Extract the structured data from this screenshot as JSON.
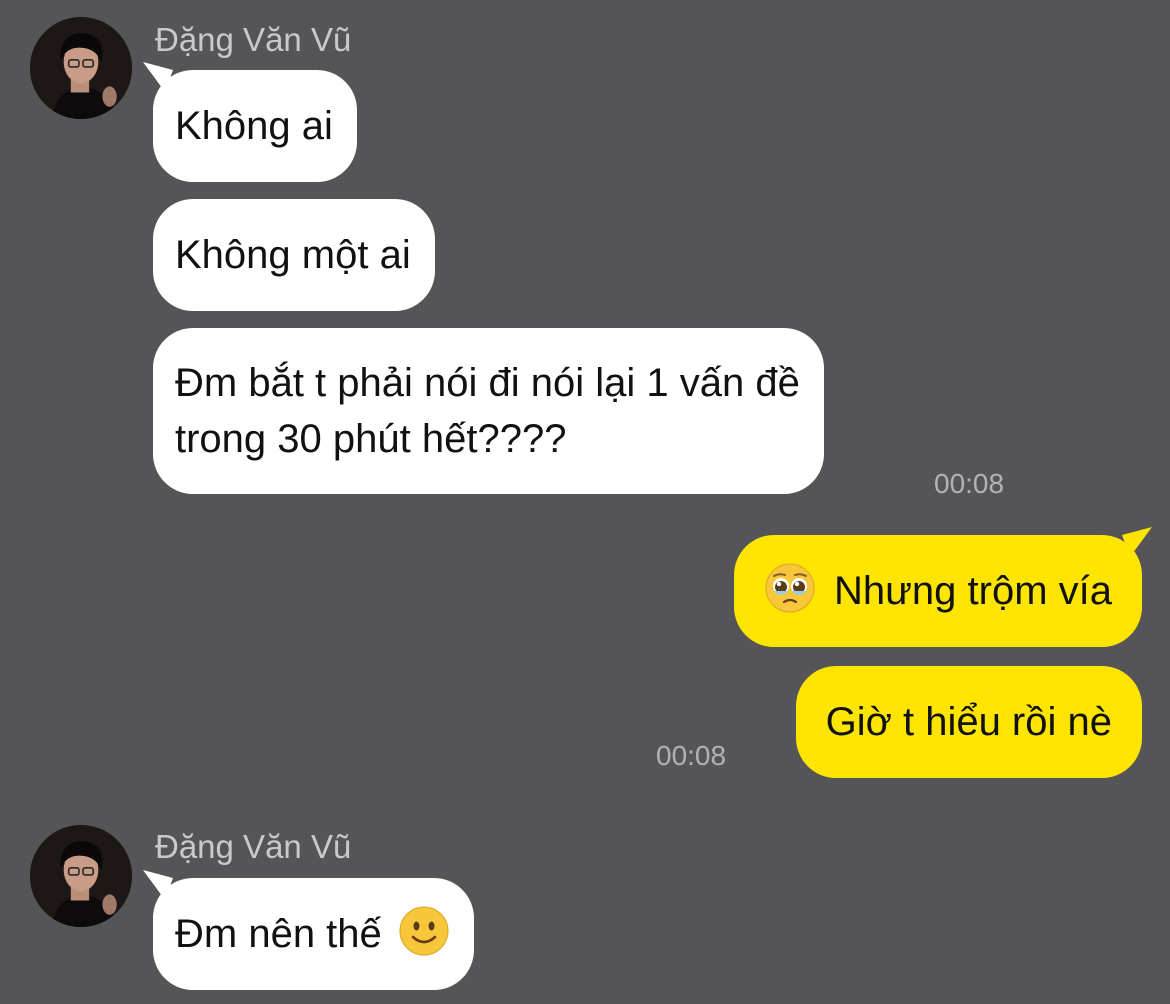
{
  "messages": [
    {
      "sender": "Đặng Văn Vũ"
    },
    {
      "text": "Không ai"
    },
    {
      "text": "Không một ai"
    },
    {
      "line1": "Đm bắt t phải nói đi nói lại 1 vấn đề",
      "line2": "trong 30 phút hết????",
      "time": "00:08"
    },
    {
      "emoji": "pleading-face",
      "text": "Nhưng trộm vía"
    },
    {
      "text": "Giờ t hiểu rồi nè",
      "time": "00:08"
    },
    {
      "sender": "Đặng Văn Vũ"
    },
    {
      "text": "Đm nên thế",
      "emoji": "slightly-smiling-face"
    }
  ],
  "colors": {
    "background": "#555557",
    "incoming_bubble": "#ffffff",
    "outgoing_bubble": "#fee500",
    "sender_text": "#c9c9cb",
    "time_text": "#b2b2b5"
  }
}
